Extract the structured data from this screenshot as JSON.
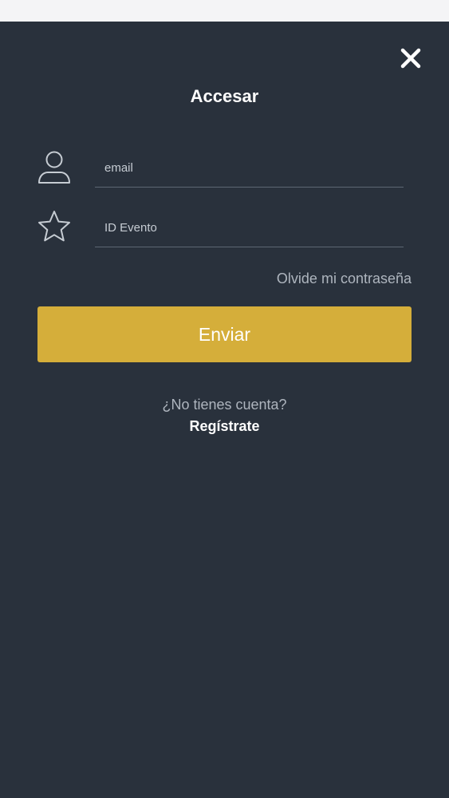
{
  "colors": {
    "background": "#29313c",
    "accent": "#d5ae3a",
    "muted_text": "#aeb5be",
    "icon_stroke": "#c6ccd3"
  },
  "header": {
    "title": "Accesar",
    "close_icon": "close-icon"
  },
  "form": {
    "email": {
      "icon": "user-icon",
      "placeholder": "email",
      "value": ""
    },
    "event_id": {
      "icon": "star-icon",
      "placeholder": "ID Evento",
      "value": ""
    },
    "forgot_password": "Olvide mi contraseña",
    "submit_label": "Enviar"
  },
  "footer": {
    "no_account": "¿No tienes cuenta?",
    "register": "Regístrate"
  }
}
